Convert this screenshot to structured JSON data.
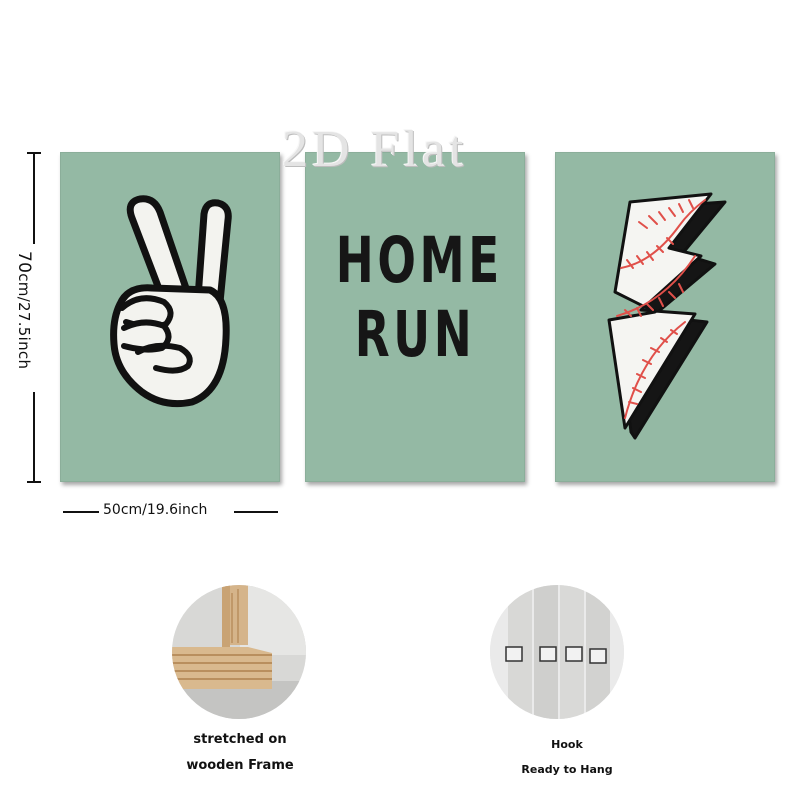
{
  "watermark": "2D Flat",
  "panels": [
    {
      "name": "peace-sign"
    },
    {
      "text_lines": [
        "HOME",
        "RUN"
      ]
    },
    {
      "name": "baseball-lightning-bolt"
    }
  ],
  "colors": {
    "panel_background": "#94b9a4",
    "ink": "#161616",
    "stitch_red": "#e0504a"
  },
  "dimensions": {
    "height_value": "70",
    "height_unit": "cm/27.5inch",
    "width_value": "50",
    "width_unit": "cm/19.6inch"
  },
  "features": [
    {
      "icon": "wooden-frame-photo",
      "caption_lines": [
        "stretched on",
        "wooden Frame"
      ]
    },
    {
      "icon": "hook-photo",
      "caption_lines": [
        "Hook",
        "Ready to Hang"
      ]
    }
  ]
}
